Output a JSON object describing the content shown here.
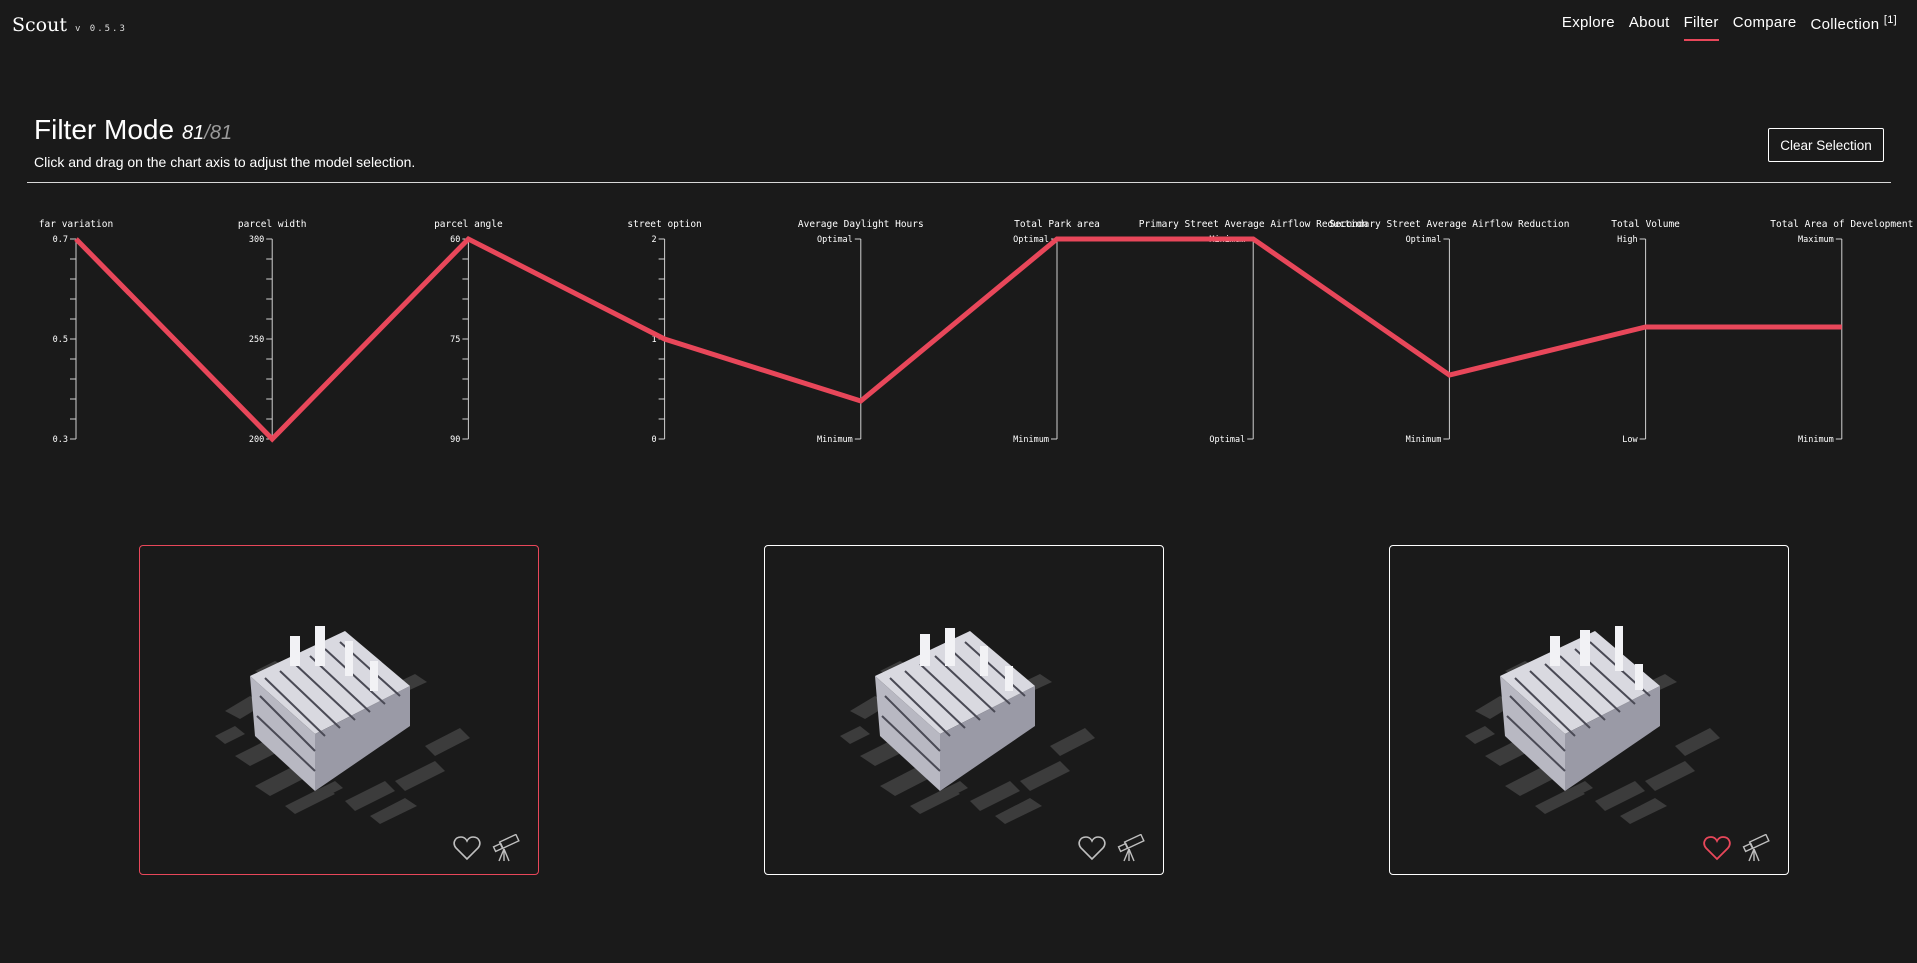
{
  "app": {
    "logo_text": "Scout",
    "version": "v 0.5.3"
  },
  "nav": [
    {
      "label": "Explore"
    },
    {
      "label": "About"
    },
    {
      "label": "Filter",
      "active": true
    },
    {
      "label": "Compare"
    },
    {
      "label": "Collection",
      "badge": "[1]"
    }
  ],
  "filter": {
    "title": "Filter Mode",
    "count": "81",
    "total": "/81",
    "subtitle": "Click and drag on the chart axis to adjust the model selection.",
    "clear_label": "Clear Selection"
  },
  "chart_data": {
    "type": "parallel-coordinates",
    "axes": [
      {
        "title": "far variation",
        "ticks": [
          "0.7",
          "0.5",
          "0.3"
        ],
        "value": 1.0
      },
      {
        "title": "parcel width",
        "ticks": [
          "300",
          "250",
          "200"
        ],
        "value": 0.0
      },
      {
        "title": "parcel angle",
        "ticks": [
          "60",
          "75",
          "90"
        ],
        "value": 1.0
      },
      {
        "title": "street option",
        "ticks": [
          "2",
          "1",
          "0"
        ],
        "value": 0.5
      },
      {
        "title": "Average Daylight Hours",
        "ticks": [
          "Optimal",
          "",
          "Minimum"
        ],
        "value": 0.19
      },
      {
        "title": "Total Park area",
        "ticks": [
          "Optimal",
          "",
          "Minimum"
        ],
        "value": 1.0
      },
      {
        "title": "Primary Street Average Airflow Reduction",
        "ticks": [
          "Minimum",
          "",
          "Optimal"
        ],
        "value": 1.0
      },
      {
        "title": "Secondary Street Average Airflow Reduction",
        "ticks": [
          "Optimal",
          "",
          "Minimum"
        ],
        "value": 0.32
      },
      {
        "title": "Total Volume",
        "ticks": [
          "High",
          "",
          "Low"
        ],
        "value": 0.56
      },
      {
        "title": "Total Area of Development",
        "ticks": [
          "Maximum",
          "",
          "Minimum"
        ],
        "value": 0.56
      }
    ],
    "line_color": "#e8475a"
  },
  "cards": [
    {
      "favorite": false,
      "selected": true
    },
    {
      "favorite": false,
      "selected": false
    },
    {
      "favorite": true,
      "selected": false
    }
  ],
  "colors": {
    "background": "#1a1a1a",
    "accent": "#e8475a",
    "text": "#ffffff"
  },
  "icons": {
    "favorite": "heart-icon",
    "explore": "telescope-icon"
  }
}
